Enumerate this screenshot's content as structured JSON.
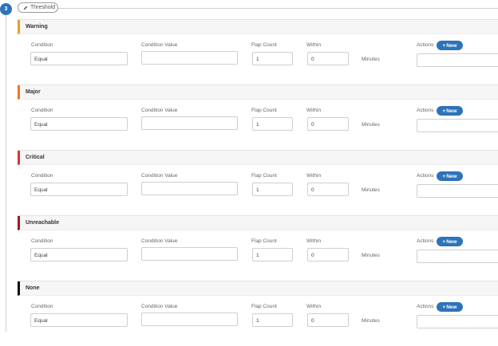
{
  "step": {
    "number": "3",
    "chip_label": "Threshold"
  },
  "columns": {
    "condition": "Condition",
    "condition_value": "Condition Value",
    "flap_count": "Flap Count",
    "within": "Within",
    "minutes": "Minutes",
    "actions": "Actions",
    "new_button": "New"
  },
  "sections": [
    {
      "title": "Warning",
      "color": "#e6a01f",
      "condition": "Equal",
      "condition_value": "",
      "flap_count": "1",
      "within": "0"
    },
    {
      "title": "Major",
      "color": "#e8782a",
      "condition": "Equal",
      "condition_value": "",
      "flap_count": "1",
      "within": "0"
    },
    {
      "title": "Critical",
      "color": "#d9362f",
      "condition": "Equal",
      "condition_value": "",
      "flap_count": "1",
      "within": "0"
    },
    {
      "title": "Unreachable",
      "color": "#a0162e",
      "condition": "Equal",
      "condition_value": "",
      "flap_count": "1",
      "within": "0"
    },
    {
      "title": "None",
      "color": "#111111",
      "condition": "Equal",
      "condition_value": "",
      "flap_count": "1",
      "within": "0"
    }
  ]
}
